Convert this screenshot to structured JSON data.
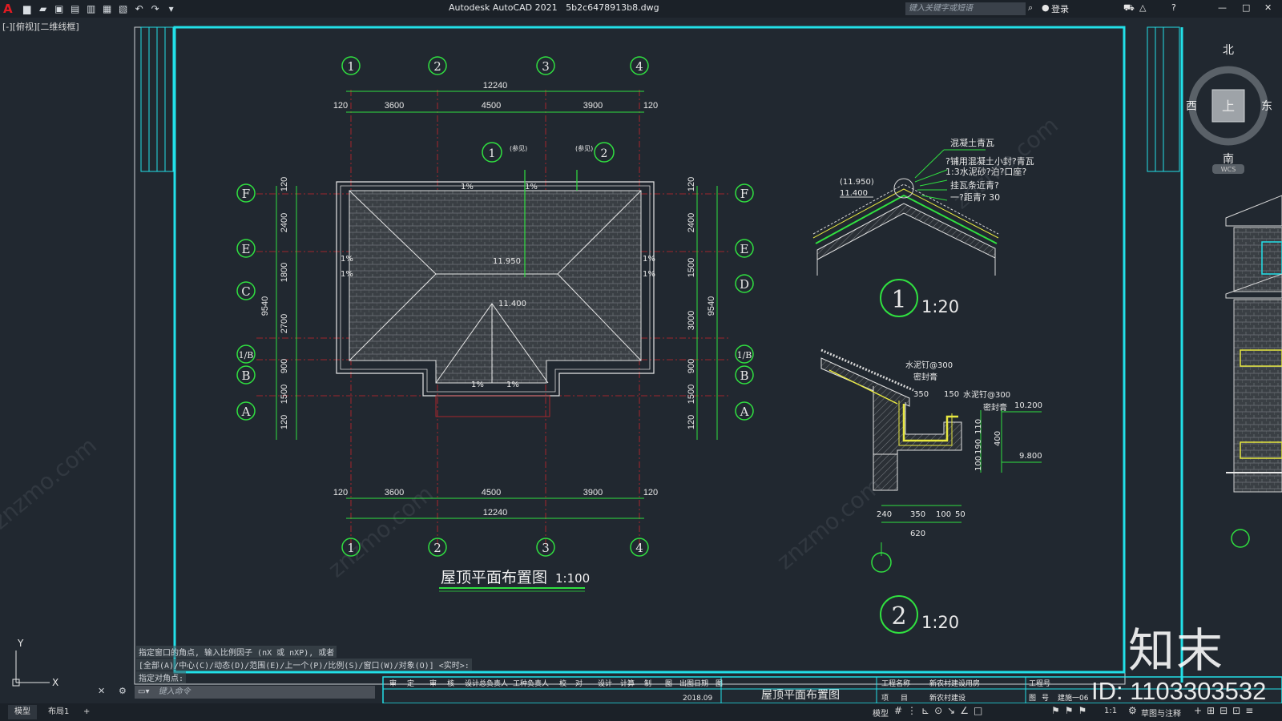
{
  "app": {
    "logo": "A",
    "title": "Autodesk AutoCAD 2021",
    "filename": "5b2c6478913b8.dwg",
    "search_placeholder": "键入关键字或短语",
    "login": "登录"
  },
  "viewport_label": "[-][俯视][二维线框]",
  "viewcube": {
    "north": "北",
    "south": "南",
    "east": "东",
    "west": "西",
    "top": "上",
    "wcs": "WCS"
  },
  "ucs": {
    "x": "X",
    "y": "Y"
  },
  "plan": {
    "title": "屋顶平面布置图",
    "scale": "1:100",
    "axes_x": [
      "1",
      "2",
      "3",
      "4"
    ],
    "axes_left": [
      "F",
      "E",
      "C",
      "1/B",
      "B",
      "A"
    ],
    "axes_right": [
      "F",
      "E",
      "D",
      "1/B",
      "B",
      "A"
    ],
    "dims_top_total": "12240",
    "dims_top": [
      "120",
      "3600",
      "4500",
      "3900",
      "120"
    ],
    "dims_left": [
      "120",
      "2400",
      "1800",
      "2700",
      "900",
      "1500",
      "120"
    ],
    "dims_left_total": "9540",
    "dims_right": [
      "120",
      "2400",
      "1500",
      "3000",
      "900",
      "1500",
      "120"
    ],
    "dims_right_total": "9540",
    "slopes": [
      "1%",
      "1%",
      "1%",
      "1%",
      "1%",
      "1%",
      "1%",
      "1%"
    ],
    "elev_ridge": "11.950",
    "elev_sub": "11.400",
    "callout1": "1",
    "callout2": "2",
    "callout_note": "(参见)"
  },
  "detail1": {
    "num": "1",
    "scale": "1:20",
    "elev_a": "(11.950)",
    "elev_b": "11.400",
    "notes": [
      "混凝土青瓦",
      "?铺用混凝土小封?青瓦",
      "1:3水泥砂?泊?口座?",
      "挂瓦条近青?",
      "一?距青? 30"
    ]
  },
  "detail2": {
    "num": "2",
    "scale": "1:20",
    "notes": [
      "水泥钉@300",
      "密封膏",
      "水泥钉@300",
      "密封膏"
    ],
    "dims": [
      "350",
      "150",
      "110",
      "190",
      "400",
      "100",
      "240",
      "350",
      "100",
      "50",
      "620"
    ],
    "elevs": [
      "10.200",
      "9.800"
    ]
  },
  "titleblock": {
    "sheet_name": "屋顶平面布置图",
    "headers": [
      "审",
      "定",
      "审",
      "核",
      "设计总负责人",
      "工种负责人",
      "校",
      "对",
      "设计",
      "计算",
      "制",
      "图",
      "出图日期",
      "图"
    ],
    "date": "2018.09",
    "right_labels": [
      "工程名称",
      "新农村建设用房",
      "工程号",
      "项",
      "目",
      "新农村建设",
      "图",
      "号",
      "建施一06"
    ]
  },
  "command": {
    "history": [
      "指定窗口的角点, 输入比例因子 (nX 或 nXP), 或者",
      "[全部(A)/中心(C)/动态(D)/范围(E)/上一个(P)/比例(S)/窗口(W)/对象(O)] <实时>:",
      "指定对角点:"
    ],
    "placeholder": "键入命令"
  },
  "tabs": [
    "模型",
    "布局1"
  ],
  "status": {
    "model": "模型",
    "scale": "1:1",
    "workspace": "草图与注释"
  },
  "watermark": {
    "brand": "知末",
    "id": "ID: 1103303532",
    "url": "znzmo.com"
  }
}
